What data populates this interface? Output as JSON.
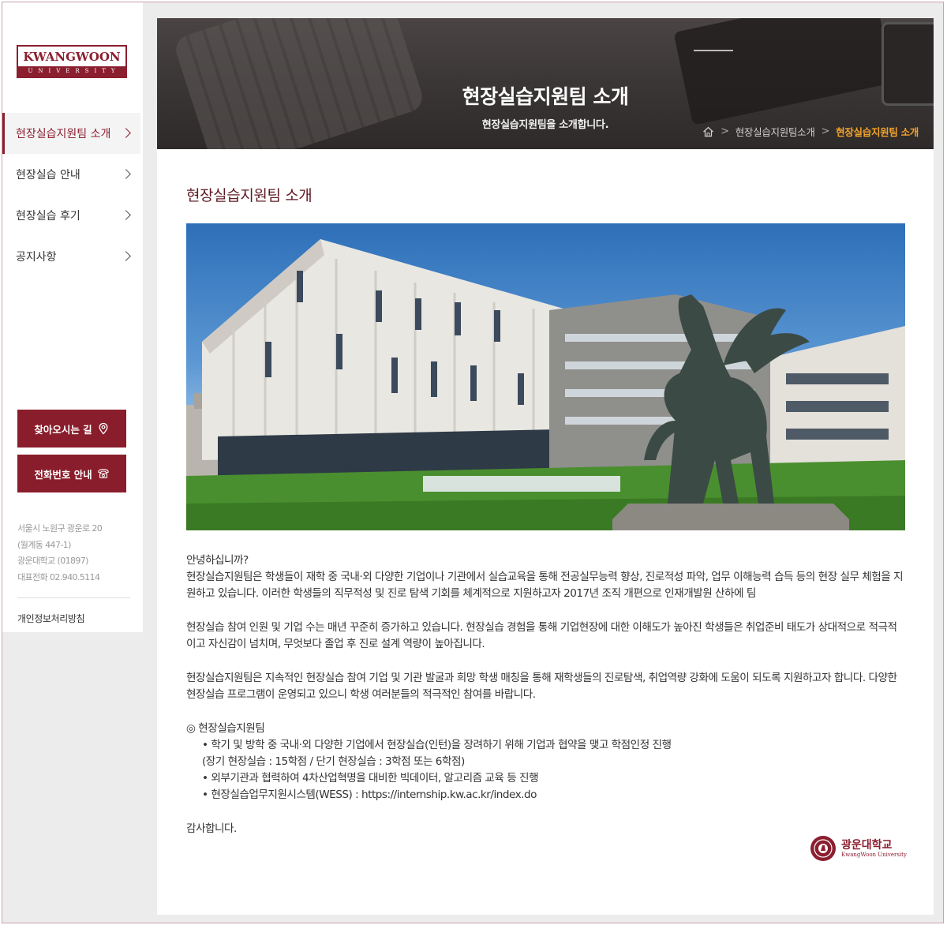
{
  "sidebar": {
    "logo_text": "KWANGWOON",
    "logo_sub": "UNIVERSITY",
    "menu": [
      {
        "label": "현장실습지원팀 소개",
        "active": true
      },
      {
        "label": "현장실습 안내",
        "active": false
      },
      {
        "label": "현장실습 후기",
        "active": false
      },
      {
        "label": "공지사항",
        "active": false
      }
    ],
    "directions_label": "찾아오시는 길",
    "phone_label": "전화번호 안내",
    "address": [
      "서울시 노원구 광운로 20",
      "(월계동 447-1)",
      "광운대학교 (01897)",
      "대표전화 02.940.5114"
    ],
    "privacy_label": "개인정보처리방침"
  },
  "banner": {
    "title": "현장실습지원팀 소개",
    "subtitle": "현장실습지원팀을 소개합니다.",
    "breadcrumb": [
      "현장실습지원팀소개",
      "현장실습지원팀 소개"
    ]
  },
  "content": {
    "title": "현장실습지원팀 소개",
    "greeting": "안녕하십니까?",
    "para1": "현장실습지원팀은 학생들이 재학 중 국내·외 다양한 기업이나 기관에서 실습교육을 통해 전공실무능력 향상, 진로적성 파악, 업무 이해능력 습득 등의 현장 실무 체험을 지원하고 있습니다. 이러한 학생들의 직무적성 및 진로 탐색 기회를 체계적으로 지원하고자 2017년 조직 개편으로 인재개발원 산하에 팀",
    "para2": "현장실습 참여 인원 및 기업 수는 매년 꾸준히 증가하고 있습니다. 현장실습 경험을 통해 기업현장에 대한 이해도가 높아진 학생들은 취업준비 태도가 상대적으로 적극적이고 자신감이 넘치며, 무엇보다 졸업 후 진로 설계 역량이 높아집니다.",
    "para3": "현장실습지원팀은 지속적인 현장실습 참여 기업 및 기관 발굴과 희망 학생 매칭을 통해 재학생들의 진로탐색, 취업역량 강화에 도움이 되도록 지원하고자 합니다. 다양한 현장실습 프로그램이 운영되고 있으니 학생 여러분들의 적극적인 참여를 바랍니다.",
    "team_heading": "◎ 현장실습지원팀",
    "bullet1": "• 학기 및 방학 중 국내·외 다양한 기업에서 현장실습(인턴)을 장려하기 위해 기업과 협약을 맺고 학점인정 진행",
    "bullet1b": "(장기 현장실습 : 15학점 / 단기 현장실습 : 3학점 또는 6학점)",
    "bullet2": "• 외부기관과 협력하여 4차산업혁명을 대비한 빅데이터, 알고리즘 교육 등 진행",
    "bullet3": "• 현장실습업무지원시스템(WESS) : https://internship.kw.ac.kr/index.do",
    "closing": "감사합니다.",
    "seal_name": "광운대학교",
    "seal_en": "KwangWoon University"
  },
  "colors": {
    "brand": "#8b1f2f",
    "breadcrumb_current": "#f3a32b"
  }
}
